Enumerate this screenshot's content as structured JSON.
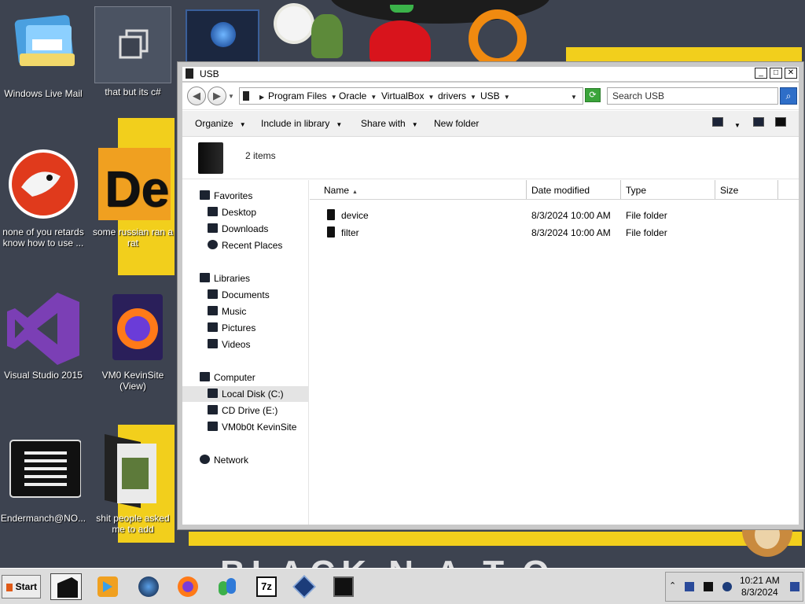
{
  "desktop": {
    "icons": [
      {
        "label": "Windows Live Mail"
      },
      {
        "label": "that but its c#"
      },
      {
        "label": "none of you retards know how to use ..."
      },
      {
        "label": "some russian ran a rat"
      },
      {
        "label": "Visual Studio 2015"
      },
      {
        "label": "VM0 KevinSite (View)"
      },
      {
        "label": "Endermanch@NO..."
      },
      {
        "label": "shit people asked me to add"
      }
    ],
    "wallpaper_text": "BLACK N.A.T.O."
  },
  "window": {
    "title": "USB",
    "buttons": {
      "minimize": "_",
      "maximize": "□",
      "close": "✕"
    },
    "breadcrumb": [
      "Program Files",
      "Oracle",
      "VirtualBox",
      "drivers",
      "USB"
    ],
    "search_placeholder": "Search USB",
    "toolbar": {
      "organize": "Organize",
      "include_in_library": "Include in library",
      "share_with": "Share with",
      "new_folder": "New folder"
    },
    "item_count": "2 items",
    "navigation": {
      "favorites": {
        "label": "Favorites",
        "items": [
          "Desktop",
          "Downloads",
          "Recent Places"
        ]
      },
      "libraries": {
        "label": "Libraries",
        "items": [
          "Documents",
          "Music",
          "Pictures",
          "Videos"
        ]
      },
      "computer": {
        "label": "Computer",
        "items": [
          "Local Disk (C:)",
          "CD Drive (E:)",
          "VM0b0t KevinSite"
        ],
        "selected": "Local Disk (C:)"
      },
      "network": {
        "label": "Network"
      }
    },
    "columns": [
      "Name",
      "Date modified",
      "Type",
      "Size"
    ],
    "files": [
      {
        "name": "device",
        "modified": "8/3/2024 10:00 AM",
        "type": "File folder",
        "size": ""
      },
      {
        "name": "filter",
        "modified": "8/3/2024 10:00 AM",
        "type": "File folder",
        "size": ""
      }
    ]
  },
  "taskbar": {
    "start": "Start",
    "apps": [
      "File Explorer",
      "Windows Media Player",
      "Globe",
      "Firefox",
      "Windows Live Messenger",
      "7-Zip",
      "VirtualBox",
      "Remote Desktop"
    ],
    "time": "10:21 AM",
    "date": "8/3/2024"
  },
  "colors": {
    "wallpaper_yellow": "#f2cf1c",
    "desktop_bg": "#3d4350",
    "taskbar": "#dcdcdc"
  }
}
